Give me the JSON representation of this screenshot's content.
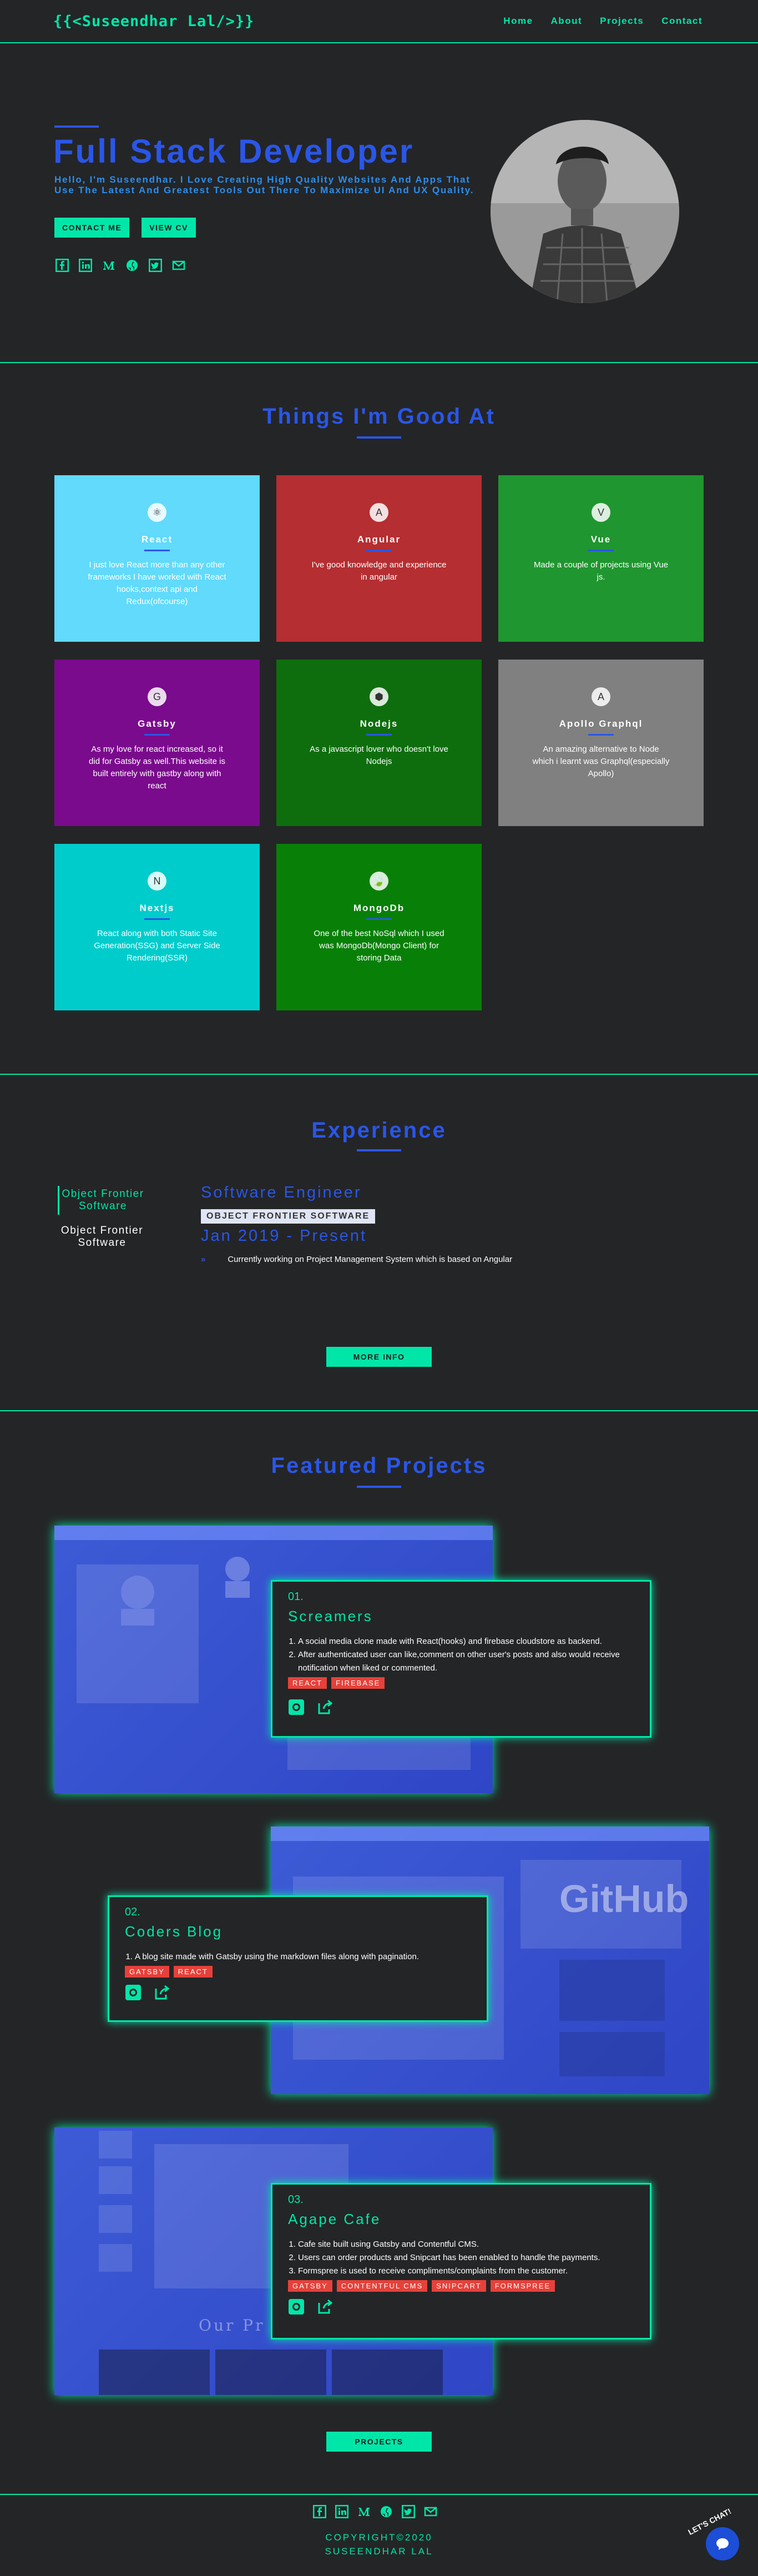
{
  "nav": {
    "logo": "{{<Suseendhar Lal/>}}",
    "links": [
      "Home",
      "About",
      "Projects",
      "Contact"
    ]
  },
  "hero": {
    "title": "Full Stack Developer",
    "subtitle": "Hello, I'm Suseendhar. I Love Creating High Quality Websites And Apps That Use The Latest And Greatest Tools Out There To Maximize UI And UX Quality.",
    "contact_btn": "CONTACT ME",
    "cv_btn": "VIEW CV",
    "social_icons": [
      "facebook-icon",
      "linkedin-icon",
      "medium-icon",
      "github-icon",
      "twitter-icon",
      "gmail-icon"
    ]
  },
  "skills": {
    "title": "Things I'm Good At",
    "items": [
      {
        "name": "React",
        "desc": "I just love React more than any other frameworks I have worked with React hooks,context api and Redux(ofcourse)",
        "color": "#61dafb",
        "icon": "react-icon"
      },
      {
        "name": "Angular",
        "desc": "I've good knowledge and experience in angular",
        "color": "#b52e31",
        "icon": "angular-icon"
      },
      {
        "name": "Vue",
        "desc": "Made a couple of projects using Vue js.",
        "color": "#1f962f",
        "icon": "vue-icon"
      },
      {
        "name": "Gatsby",
        "desc": "As my love for react increased, so it did for Gatsby as well.This website is built entirely with gastby along with react",
        "color": "#7a0b8c",
        "icon": "gatsby-icon"
      },
      {
        "name": "Nodejs",
        "desc": "As a javascript lover who doesn't love Nodejs",
        "color": "#0e6e0e",
        "icon": "nodejs-icon"
      },
      {
        "name": "Apollo Graphql",
        "desc": "An amazing alternative to Node which i learnt was Graphql(especially Apollo)",
        "color": "#808080",
        "icon": "apollo-icon"
      },
      {
        "name": "Nextjs",
        "desc": "React along with both Static Site Generation(SSG) and Server Side Rendering(SSR)",
        "color": "#00cccc",
        "icon": "nextjs-icon"
      },
      {
        "name": "MongoDb",
        "desc": "One of the best NoSql which I used was MongoDb(Mongo Client) for storing Data",
        "color": "#088008",
        "icon": "mongodb-icon"
      }
    ]
  },
  "experience": {
    "title": "Experience",
    "tabs": [
      "Object Frontier Software",
      "Object Frontier Software"
    ],
    "role": "Software Engineer",
    "company": "OBJECT FRONTIER SOFTWARE",
    "dates": "Jan 2019 - Present",
    "duty": "Currently working on Project Management System which is based on Angular",
    "more_btn": "MORE INFO"
  },
  "projects": {
    "title": "Featured Projects",
    "items": [
      {
        "num": "01.",
        "name": "Screamers",
        "points": [
          "A social media clone made with React(hooks) and firebase cloudstore as backend.",
          "After authenticated user can like,comment on other user's posts and also would receive notification when liked or commented."
        ],
        "tags": [
          "REACT",
          "FIREBASE"
        ]
      },
      {
        "num": "02.",
        "name": "Coders Blog",
        "points": [
          "A blog site made with Gatsby using the markdown files along with pagination."
        ],
        "tags": [
          "GATSBY",
          "REACT"
        ]
      },
      {
        "num": "03.",
        "name": "Agape Cafe",
        "points": [
          "Cafe site built using Gatsby and Contentful CMS.",
          "Users can order products and Snipcart has been enabled to handle the payments.",
          "Formspree is used to receive compliments/complaints from the customer."
        ],
        "tags": [
          "GATSBY",
          "CONTENTFUL CMS",
          "SNIPCART",
          "FORMSPREE"
        ]
      }
    ],
    "projects_btn": "PROJECTS",
    "shot_text": [
      "GitHub",
      "Our Pr"
    ]
  },
  "footer": {
    "copyright": "COPYRIGHT©2020",
    "name": "SUSEENDHAR LAL",
    "chat_label": "LET'S CHAT!"
  },
  "colors": {
    "accent": "#00e6a8",
    "brand": "#2a56e8",
    "bg": "#242526",
    "tag": "#e6413a"
  }
}
